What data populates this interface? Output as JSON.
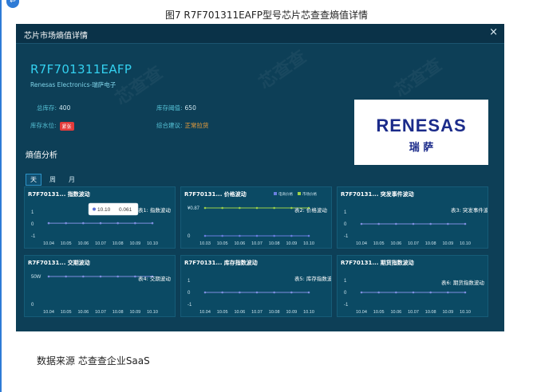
{
  "figure": {
    "caption": "图7  R7F701311EAFP型号芯片芯查查熵值详情",
    "footer": "数据来源  芯查查企业SaaS",
    "badge_glyph": "↩"
  },
  "modal": {
    "title": "芯片市场熵值详情",
    "close_glyph": "×",
    "chip_name": "R7F701311EAFP",
    "vendor": "Renesas Electronics-瑞萨电子",
    "fields": {
      "total_stock_label": "总库存:",
      "total_stock_value": "400",
      "stock_threshold_label": "库存阈值:",
      "stock_threshold_value": "650",
      "stock_level_label": "库存水位:",
      "stock_level_badge": "紧张",
      "advice_label": "综合建议:",
      "advice_value": "正常拉货"
    },
    "logo": {
      "wordmark": "RENESAS",
      "chinese": "瑞 萨",
      "brand_color": "#1b2b8a"
    },
    "section_title": "熵值分析",
    "tabs": [
      {
        "label": "天",
        "active": true
      },
      {
        "label": "周",
        "active": false
      },
      {
        "label": "月",
        "active": false
      }
    ]
  },
  "chart_data": [
    {
      "type": "line",
      "title": "R7F70131... 指数波动",
      "annotation": "表1: 指数波动",
      "x": [
        "10.04",
        "10.05",
        "10.06",
        "10.07",
        "10.08",
        "10.09",
        "10.10"
      ],
      "yticks": [
        "1",
        "0",
        "-1"
      ],
      "ylim": [
        -1,
        1
      ],
      "series": [
        {
          "values": [
            0.061,
            0.061,
            0.061,
            0.061,
            0.061,
            0.061,
            0.061
          ],
          "color": "#7f8fe0"
        }
      ],
      "tooltip": {
        "date": "10.10",
        "value": "0.061"
      }
    },
    {
      "type": "line",
      "title": "R7F70131... 价格波动",
      "annotation": "表2: 价格波动",
      "legend": [
        {
          "name": "电商价格",
          "color": "#6a7fe0"
        },
        {
          "name": "市场价格",
          "color": "#9ed24a"
        }
      ],
      "x": [
        "10.03",
        "10.05",
        "10.06",
        "10.07",
        "10.08",
        "10.09",
        "10.10"
      ],
      "yticks": [
        "¥0.87",
        "0"
      ],
      "series": [
        {
          "values": [
            0.87,
            0.87,
            0.87,
            0.87,
            0.87,
            0.87,
            0.87
          ],
          "color": "#9ed24a"
        },
        {
          "values": [
            0,
            0,
            0,
            0,
            0,
            0,
            0
          ],
          "color": "#6a7fe0"
        }
      ]
    },
    {
      "type": "line",
      "title": "R7F70131... 突发事件波动",
      "annotation": "表3: 突发事件波动",
      "x": [
        "10.04",
        "10.05",
        "10.06",
        "10.07",
        "10.08",
        "10.09",
        "10.10"
      ],
      "yticks": [
        "1",
        "0",
        "-1"
      ],
      "ylim": [
        -1,
        1
      ],
      "series": [
        {
          "values": [
            0,
            0,
            0,
            0,
            0,
            0,
            0
          ],
          "color": "#7f8fe0"
        }
      ]
    },
    {
      "type": "line",
      "title": "R7F70131... 交期波动",
      "annotation": "表4: 交期波动",
      "x": [
        "10.04",
        "10.05",
        "10.06",
        "10.07",
        "10.08",
        "10.09",
        "10.10"
      ],
      "yticks": [
        "50W",
        "0"
      ],
      "series": [
        {
          "values": [
            50,
            50,
            50,
            50,
            50,
            50,
            50
          ],
          "color": "#7f8fe0"
        }
      ]
    },
    {
      "type": "line",
      "title": "R7F70131... 库存指数波动",
      "annotation": "表5: 库存指数波动",
      "x": [
        "10.04",
        "10.05",
        "10.06",
        "10.07",
        "10.08",
        "10.09",
        "10.10"
      ],
      "yticks": [
        "1",
        "0",
        "-1"
      ],
      "ylim": [
        -1,
        1
      ],
      "series": [
        {
          "values": [
            0,
            0,
            0,
            0,
            0,
            0,
            0
          ],
          "color": "#7f8fe0"
        }
      ]
    },
    {
      "type": "line",
      "title": "R7F70131... 期货指数波动",
      "annotation": "表6: 期货指数波动",
      "x": [
        "10.04",
        "10.05",
        "10.06",
        "10.07",
        "10.08",
        "10.09",
        "10.10"
      ],
      "yticks": [
        "1",
        "0",
        "-1"
      ],
      "ylim": [
        -1,
        1
      ],
      "series": [
        {
          "values": [
            0,
            0,
            0,
            0,
            0,
            0,
            0
          ],
          "color": "#7f8fe0"
        }
      ]
    }
  ]
}
